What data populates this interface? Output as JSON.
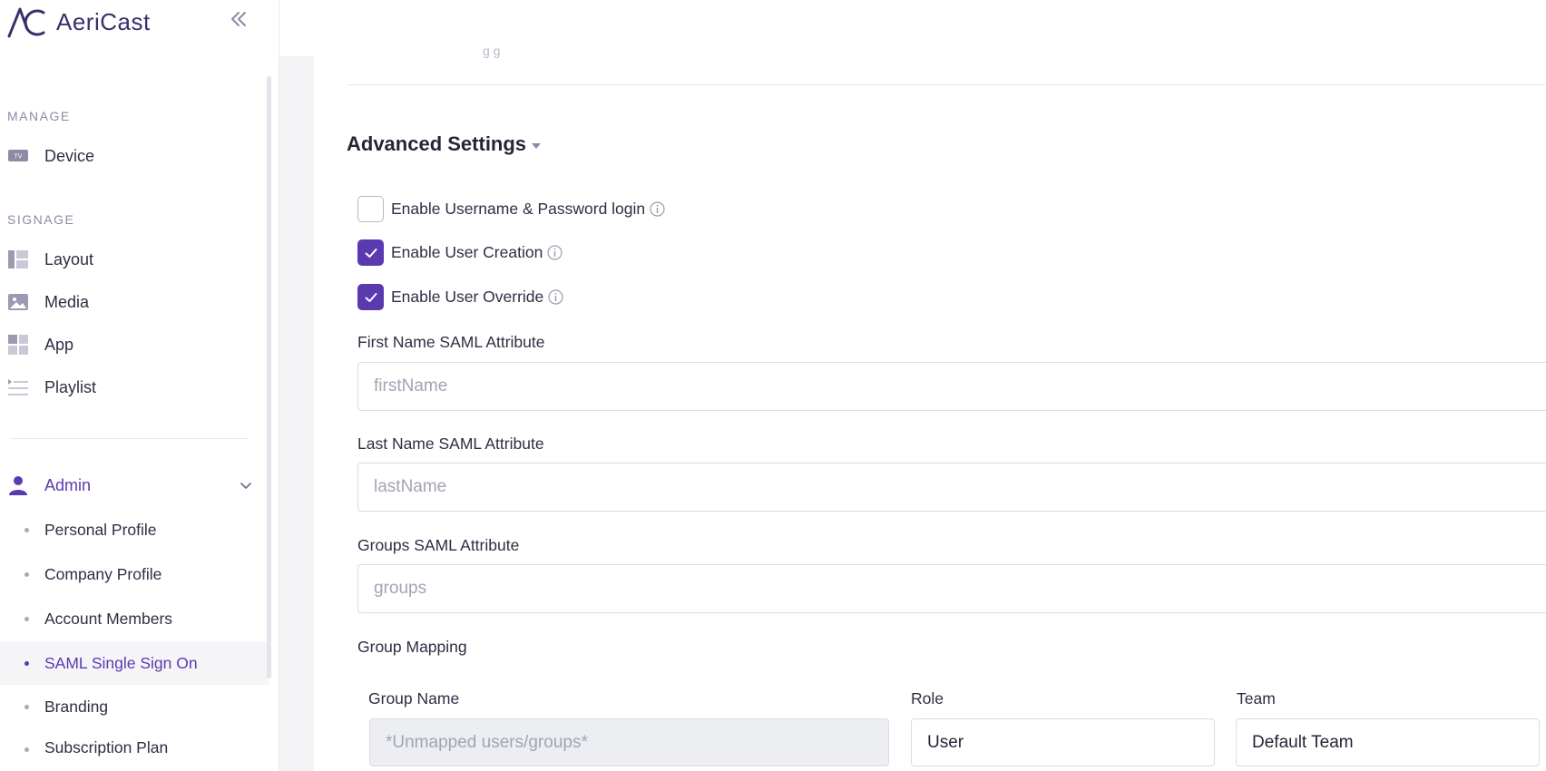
{
  "brand": {
    "name": "AeriCast"
  },
  "sidebar": {
    "manage_label": "MANAGE",
    "signage_label": "SIGNAGE",
    "device": "Device",
    "device_icon_text": "TV",
    "layout": "Layout",
    "media": "Media",
    "app": "App",
    "playlist": "Playlist",
    "admin": "Admin",
    "admin_items": [
      "Personal Profile",
      "Company Profile",
      "Account Members",
      "SAML Single Sign On",
      "Branding",
      "Subscription Plan"
    ],
    "selected_item": "SAML Single Sign On"
  },
  "main": {
    "faded_text": "g  g",
    "advanced_title": "Advanced Settings",
    "checks": [
      {
        "label": "Enable Username & Password login",
        "checked": false
      },
      {
        "label": "Enable User Creation",
        "checked": true
      },
      {
        "label": "Enable User Override",
        "checked": true
      }
    ],
    "first_name": {
      "label": "First Name SAML Attribute",
      "placeholder": "firstName"
    },
    "last_name": {
      "label": "Last Name SAML Attribute",
      "placeholder": "lastName"
    },
    "groups": {
      "label": "Groups SAML Attribute",
      "placeholder": "groups"
    },
    "group_mapping": {
      "title": "Group Mapping",
      "col_group": "Group Name",
      "col_role": "Role",
      "col_team": "Team",
      "row": {
        "group_placeholder": "*Unmapped users/groups*",
        "role": "User",
        "team": "Default Team"
      }
    }
  },
  "colors": {
    "accent": "#5b3ab0",
    "text": "#2e2e45",
    "muted": "#8c8ca3"
  }
}
